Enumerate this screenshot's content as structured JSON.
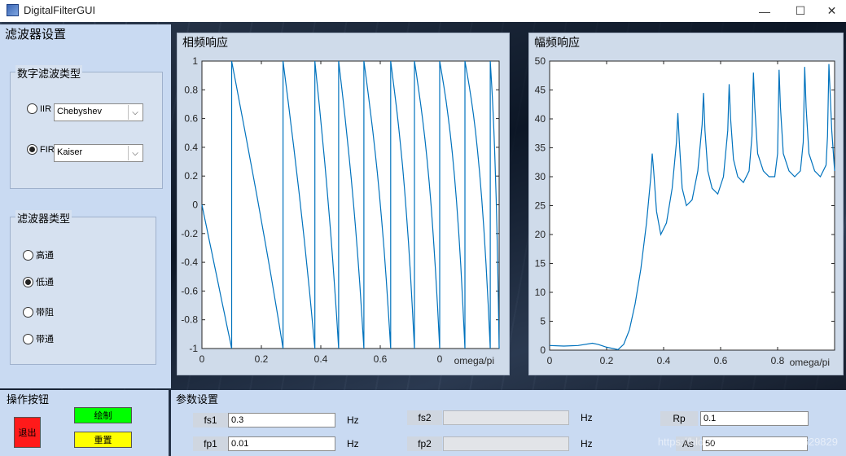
{
  "window": {
    "title": "DigitalFilterGUI",
    "minimize": "—",
    "maximize": "☐",
    "close": "✕"
  },
  "filter_settings": {
    "title": "滤波器设置",
    "digital_type": {
      "title": "数字滤波类型",
      "options": [
        {
          "label": "IIR",
          "selected": false,
          "value": "Chebyshev"
        },
        {
          "label": "FIR",
          "selected": true,
          "value": "Kaiser"
        }
      ]
    },
    "filter_type": {
      "title": "滤波器类型",
      "options": [
        {
          "label": "高通",
          "selected": false
        },
        {
          "label": "低通",
          "selected": true
        },
        {
          "label": "带阻",
          "selected": false
        },
        {
          "label": "带通",
          "selected": false
        }
      ]
    }
  },
  "charts": {
    "phase_title": "相频响应",
    "magnitude_title": "幅频响应"
  },
  "chart_data": [
    {
      "type": "line",
      "title": "相频响应",
      "xlabel": "omega/pi",
      "ylabel": "",
      "xlim": [
        0,
        1
      ],
      "ylim": [
        -1,
        1
      ],
      "x_ticks": [
        "0",
        "0.2",
        "0.4",
        "0.6",
        "0"
      ],
      "y_ticks": [
        "1",
        "0.8",
        "0.6",
        "0.4",
        "0.2",
        "0",
        "-0.2",
        "-0.4",
        "-0.6",
        "-0.8",
        "-1"
      ],
      "wrap_x": [
        0.0,
        0.1,
        0.273,
        0.38,
        0.46,
        0.545,
        0.635,
        0.715,
        0.8,
        0.885,
        0.97
      ],
      "grid": false
    },
    {
      "type": "line",
      "title": "幅频响应",
      "xlabel": "omega/pi",
      "ylabel": "",
      "xlim": [
        0,
        1
      ],
      "ylim": [
        0,
        50
      ],
      "x_ticks": [
        "0",
        "0.2",
        "0.4",
        "0.6",
        "0.8"
      ],
      "y_ticks": [
        "50",
        "45",
        "40",
        "35",
        "30",
        "25",
        "20",
        "15",
        "10",
        "5",
        "0"
      ],
      "grid": false,
      "x": [
        0,
        0.05,
        0.1,
        0.15,
        0.17,
        0.2,
        0.24,
        0.26,
        0.28,
        0.3,
        0.32,
        0.34,
        0.355,
        0.36,
        0.365,
        0.375,
        0.39,
        0.41,
        0.43,
        0.445,
        0.45,
        0.455,
        0.465,
        0.48,
        0.5,
        0.52,
        0.535,
        0.54,
        0.545,
        0.555,
        0.57,
        0.59,
        0.61,
        0.625,
        0.63,
        0.635,
        0.645,
        0.66,
        0.68,
        0.7,
        0.71,
        0.715,
        0.72,
        0.73,
        0.75,
        0.77,
        0.79,
        0.8,
        0.805,
        0.81,
        0.82,
        0.84,
        0.86,
        0.88,
        0.89,
        0.895,
        0.9,
        0.91,
        0.93,
        0.95,
        0.97,
        0.975,
        0.98,
        0.99,
        1.0
      ],
      "y": [
        0.8,
        0.7,
        0.8,
        1.2,
        1.0,
        0.5,
        0.1,
        1.0,
        3.5,
        8,
        14,
        22,
        30,
        34,
        31,
        24,
        20,
        22,
        28,
        36,
        41,
        36,
        28,
        25,
        26,
        31,
        39,
        44.5,
        38,
        31,
        28,
        27,
        30,
        38,
        46,
        40,
        33,
        30,
        29,
        31,
        37,
        48,
        42,
        34,
        31,
        30,
        30,
        34,
        48.5,
        42,
        34,
        31,
        30,
        31,
        36,
        49,
        42,
        34,
        31,
        30,
        32,
        37,
        49.5,
        38,
        31
      ]
    }
  ],
  "operations": {
    "title": "操作按钮",
    "exit": "退出",
    "draw": "绘制",
    "reset": "重置"
  },
  "parameters": {
    "title": "参数设置",
    "fs1": {
      "label": "fs1",
      "value": "0.3",
      "unit": "Hz"
    },
    "fp1": {
      "label": "fp1",
      "value": "0.01",
      "unit": "Hz"
    },
    "fs2": {
      "label": "fs2",
      "value": "",
      "unit": "Hz"
    },
    "fp2": {
      "label": "fp2",
      "value": "",
      "unit": "Hz"
    },
    "rp": {
      "label": "Rp",
      "value": "0.1"
    },
    "as": {
      "label": "As",
      "value": "50"
    }
  },
  "watermark": "https://blog.csdn.net/weixin_49629829",
  "colors": {
    "panel": "#c9daf2",
    "line": "#0072bd",
    "exit_button": "#ff1a1a",
    "draw_button": "#00ff00",
    "reset_button": "#ffff00"
  }
}
